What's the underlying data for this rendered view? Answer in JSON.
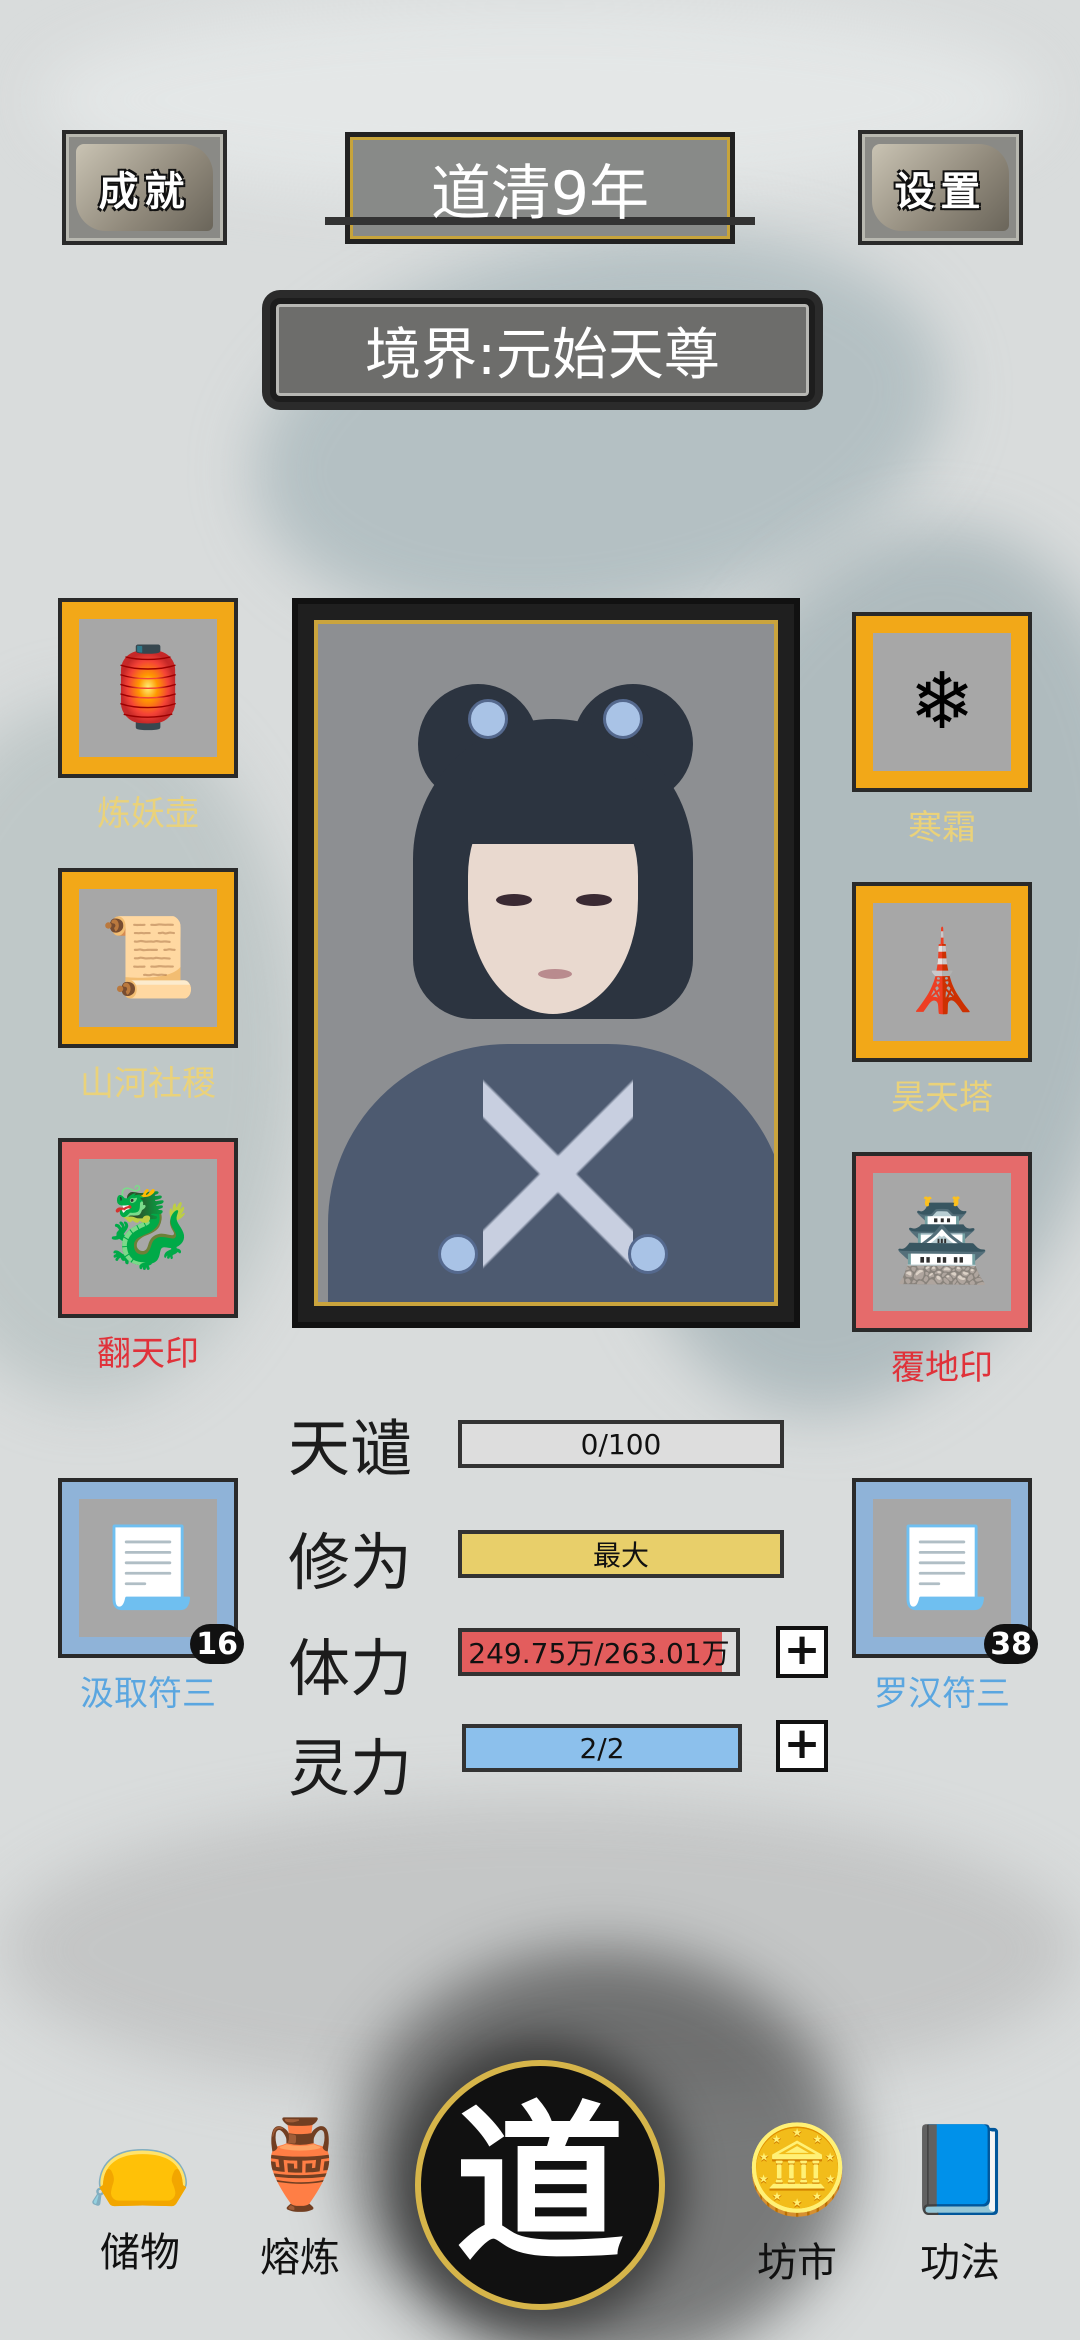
{
  "header": {
    "achievement_label": "成就",
    "settings_label": "设置",
    "year": "道清9年",
    "realm": "境界:元始天尊"
  },
  "left_items": [
    {
      "name": "炼妖壶",
      "icon": "pot-icon",
      "rarity": "gold"
    },
    {
      "name": "山河社稷",
      "icon": "scroll-map-icon",
      "rarity": "gold"
    },
    {
      "name": "翻天印",
      "icon": "seal-icon",
      "rarity": "red"
    }
  ],
  "right_items": [
    {
      "name": "寒霜",
      "icon": "frost-orb-icon",
      "rarity": "gold"
    },
    {
      "name": "昊天塔",
      "icon": "tower-icon",
      "rarity": "gold"
    },
    {
      "name": "覆地印",
      "icon": "earth-seal-icon",
      "rarity": "red"
    }
  ],
  "talismans": {
    "left": {
      "name": "汲取符三",
      "count": "16",
      "icon": "talisman-icon"
    },
    "right": {
      "name": "罗汉符三",
      "count": "38",
      "icon": "talisman-icon"
    }
  },
  "stats": {
    "tribulation": {
      "label": "天谴",
      "value": "0/100",
      "fraction": 0
    },
    "cultivation": {
      "label": "修为",
      "value": "最大",
      "fraction": 1
    },
    "stamina": {
      "label": "体力",
      "value": "249.75万/263.01万",
      "fraction": 0.95
    },
    "spirit": {
      "label": "灵力",
      "value": "2/2",
      "fraction": 1
    },
    "plus_symbol": "+"
  },
  "nav": {
    "storage": "储物",
    "smelt": "熔炼",
    "dao": "道",
    "market": "坊市",
    "skills": "功法"
  },
  "colors": {
    "gold_slot": "#f2a818",
    "red_slot": "#e56b6b",
    "blue_slot": "#8fb3d8",
    "tribulation_bar": "#7d7d7d",
    "cultivation_bar": "#e8cf6a",
    "stamina_bar": "#e35d5d",
    "spirit_bar": "#8cc0ec"
  }
}
